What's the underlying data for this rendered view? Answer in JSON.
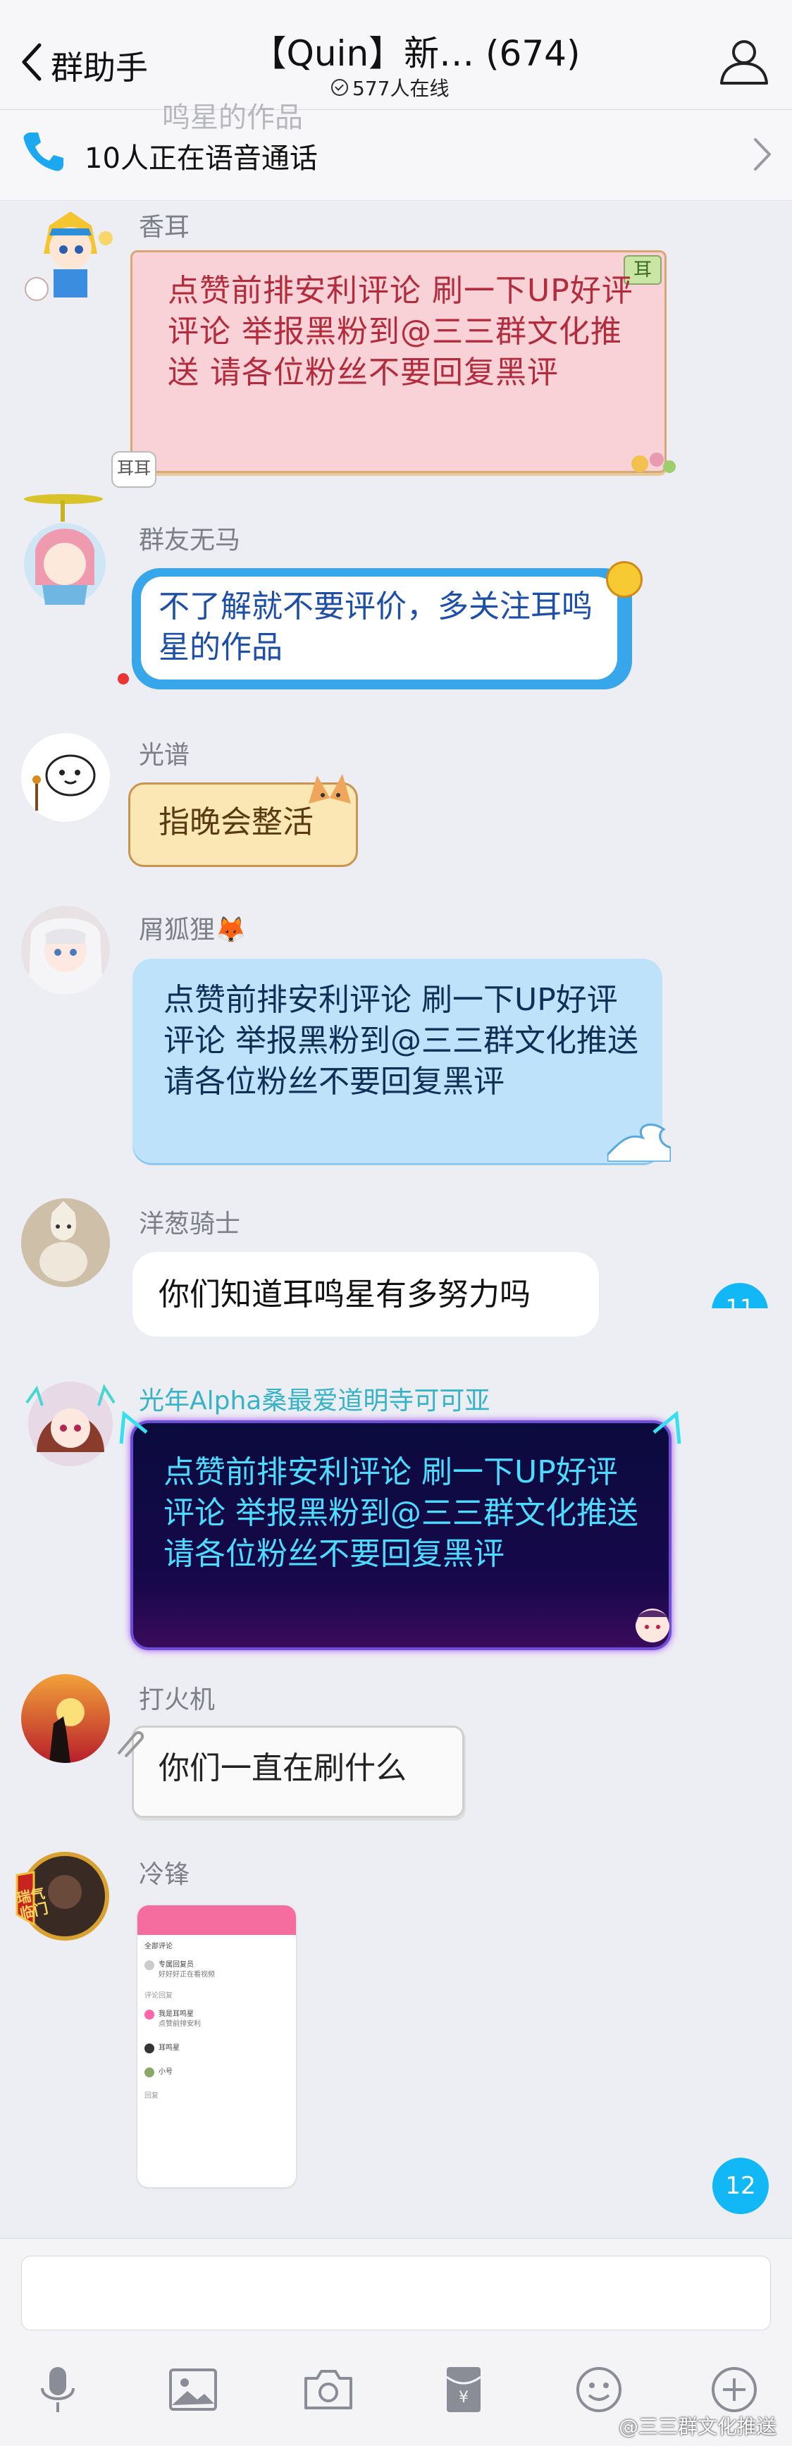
{
  "header": {
    "back_label": "群助手",
    "title": "【Quin】新… (674)",
    "online": "577人在线"
  },
  "call_bar": {
    "text": "10人正在语音通话",
    "ghost_text": "鸣星的作品"
  },
  "messages": [
    {
      "name": "香耳",
      "text": "点赞前排安利评论 刷一下UP好评评论 举报黑粉到@三三群文化推送 请各位粉丝不要回复黑评",
      "bubble": "pink-paper",
      "bubble_tag": "耳",
      "sticker_text": "耳耳"
    },
    {
      "name": "群友无马",
      "text": "不了解就不要评价，多关注耳鸣星的作品",
      "bubble": "blue-outline"
    },
    {
      "name": "光谱",
      "text": "指晚会整活",
      "bubble": "cream-cat"
    },
    {
      "name": "屑狐狸🦊",
      "text": "点赞前排安利评论 刷一下UP好评评论 举报黑粉到@三三群文化推送 请各位粉丝不要回复黑评",
      "bubble": "light-blue"
    },
    {
      "name": "洋葱骑士",
      "text": "你们知道耳鸣星有多努力吗",
      "bubble": "white",
      "side_badge": "11"
    },
    {
      "name": "光年Alpha桑最爱道明寺可可亚",
      "text": "点赞前排安利评论 刷一下UP好评评论 举报黑粉到@三三群文化推送 请各位粉丝不要回复黑评",
      "bubble": "dark-neon"
    },
    {
      "name": "打火机",
      "text": "你们一直在刷什么",
      "bubble": "paper-white"
    },
    {
      "name": "冷锋",
      "image": "screenshot-thumbnail",
      "avatar_text": "瑞气临门"
    }
  ],
  "unread_badge": "12",
  "thumbnail": {
    "header_label": "全部评论",
    "section_label": "评论回复",
    "name_1": "专属回复员",
    "name_2": "我是耳鸣星",
    "name_3": "耳鸣星",
    "name_4": "小号",
    "footer_label": "回复",
    "line_1": "好好好正在看视频",
    "line_2": "点赞前排安利"
  },
  "toolbar": [
    "mic-icon",
    "image-icon",
    "camera-icon",
    "red-packet-icon",
    "emoji-icon",
    "plus-icon"
  ],
  "watermark": "@三三群文化推送",
  "colors": {
    "accent": "#12b7f5",
    "neon": "#4bdcff",
    "pink_bubble": "#f8d2d6"
  }
}
